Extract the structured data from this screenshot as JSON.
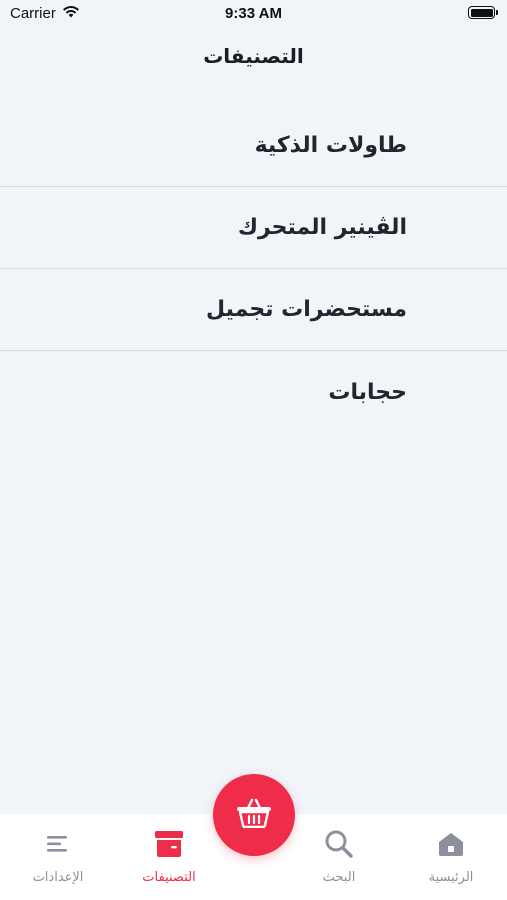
{
  "status_bar": {
    "carrier": "Carrier",
    "time": "9:33 AM"
  },
  "nav": {
    "title": "التصنيفات"
  },
  "categories": [
    {
      "label": "طاولات الذكية"
    },
    {
      "label": "الڤينير المتحرك"
    },
    {
      "label": "مستحضرات تجميل"
    },
    {
      "label": "حجابات"
    }
  ],
  "tab_bar": {
    "tabs": [
      {
        "label": "الإعدادات",
        "icon": "menu-icon",
        "active": false
      },
      {
        "label": "التصنيفات",
        "icon": "archive-box-icon",
        "active": true
      },
      {
        "label": "البحث",
        "icon": "search-icon",
        "active": false
      },
      {
        "label": "الرئيسية",
        "icon": "home-icon",
        "active": false
      }
    ],
    "center_button_icon": "basket-icon"
  },
  "colors": {
    "accent": "#ef2d4a",
    "background": "#f1f4f9",
    "inactive": "#8c909c"
  }
}
